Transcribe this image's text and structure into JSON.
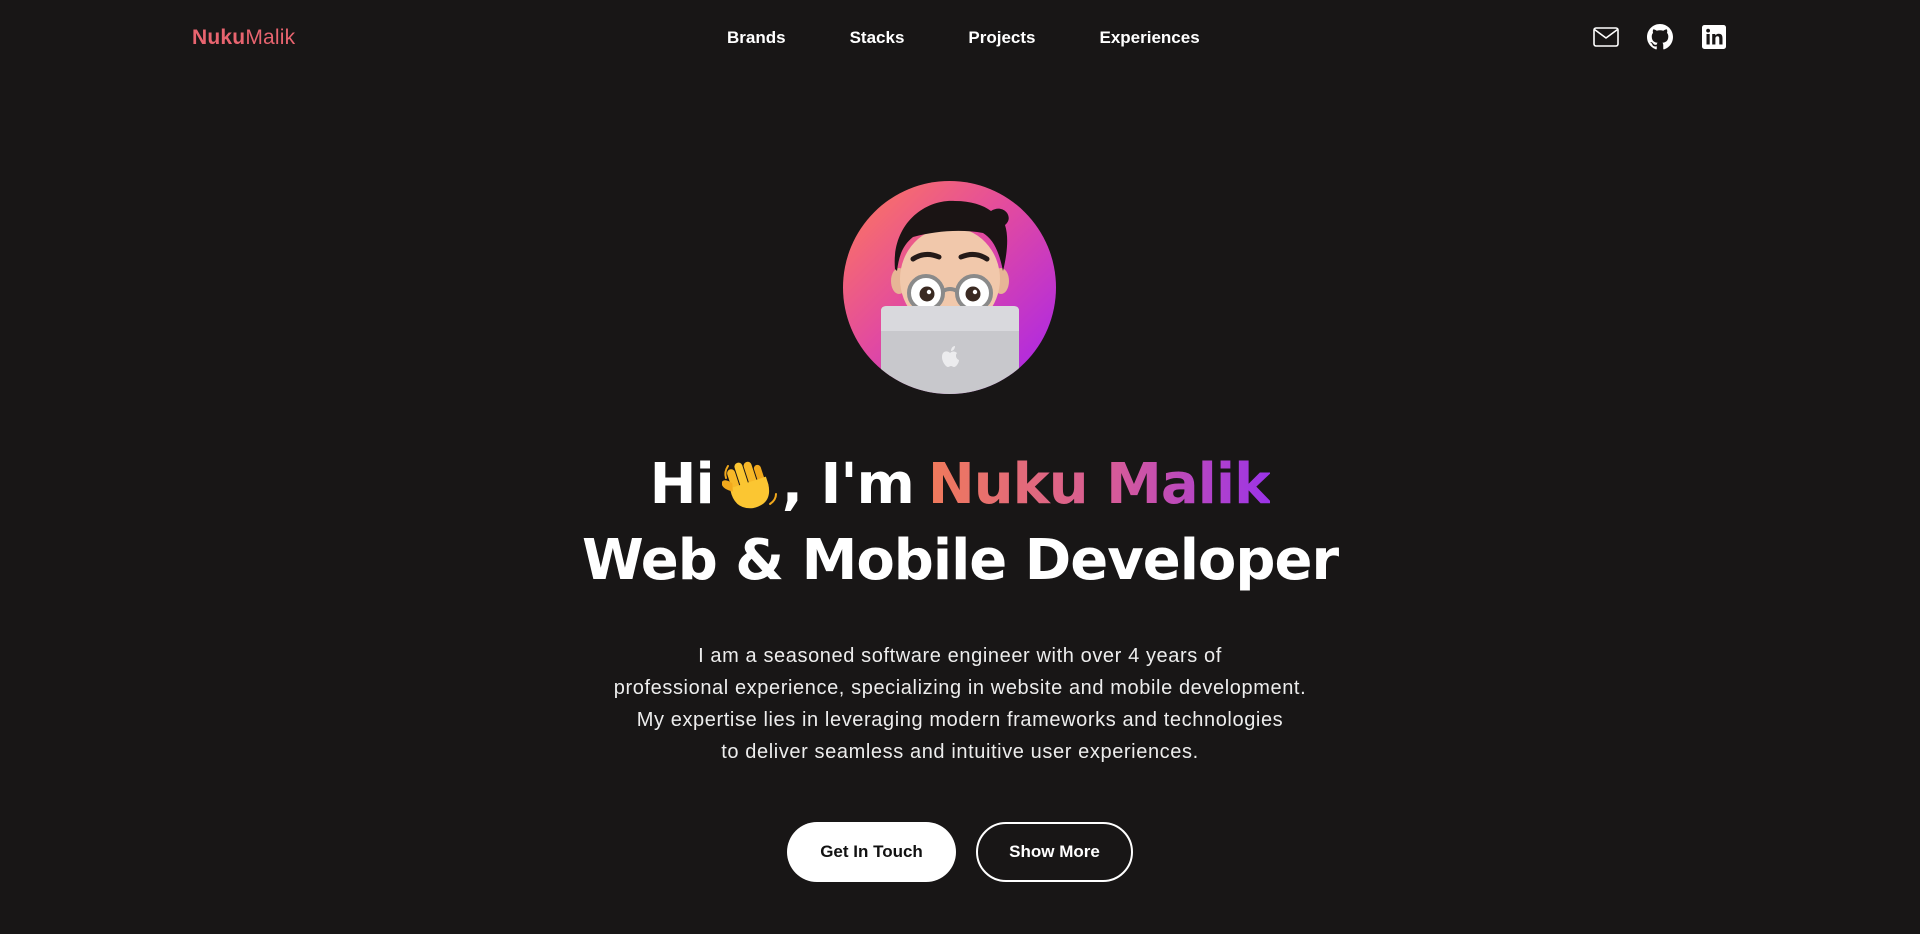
{
  "header": {
    "logo_primary": "Nuku",
    "logo_secondary": "Malik",
    "nav": [
      {
        "label": "Brands"
      },
      {
        "label": "Stacks"
      },
      {
        "label": "Projects"
      },
      {
        "label": "Experiences"
      }
    ],
    "social_icons": [
      "mail-icon",
      "github-icon",
      "linkedin-icon"
    ]
  },
  "hero": {
    "avatar_icon": "memoji-avatar-with-laptop",
    "greeting_hi": "Hi",
    "greeting_wave_icon": "waving-hand-emoji",
    "greeting_im": ", I'm",
    "name": "Nuku Malik",
    "role": "Web & Mobile Developer",
    "intro_lines": [
      "I am a seasoned software engineer with over 4 years of",
      "professional experience, specializing in website and mobile development.",
      "My expertise lies in leveraging modern frameworks and technologies",
      "to deliver seamless and intuitive user experiences."
    ],
    "primary_button": "Get In Touch",
    "secondary_button": "Show More"
  },
  "colors": {
    "background": "#181616",
    "logo": "#e8646f",
    "name_gradient": [
      "#f07a5a",
      "#d55a9a",
      "#9b33e8"
    ],
    "avatar_gradient": [
      "#ff7a59",
      "#e24aa0",
      "#a422f0"
    ]
  }
}
